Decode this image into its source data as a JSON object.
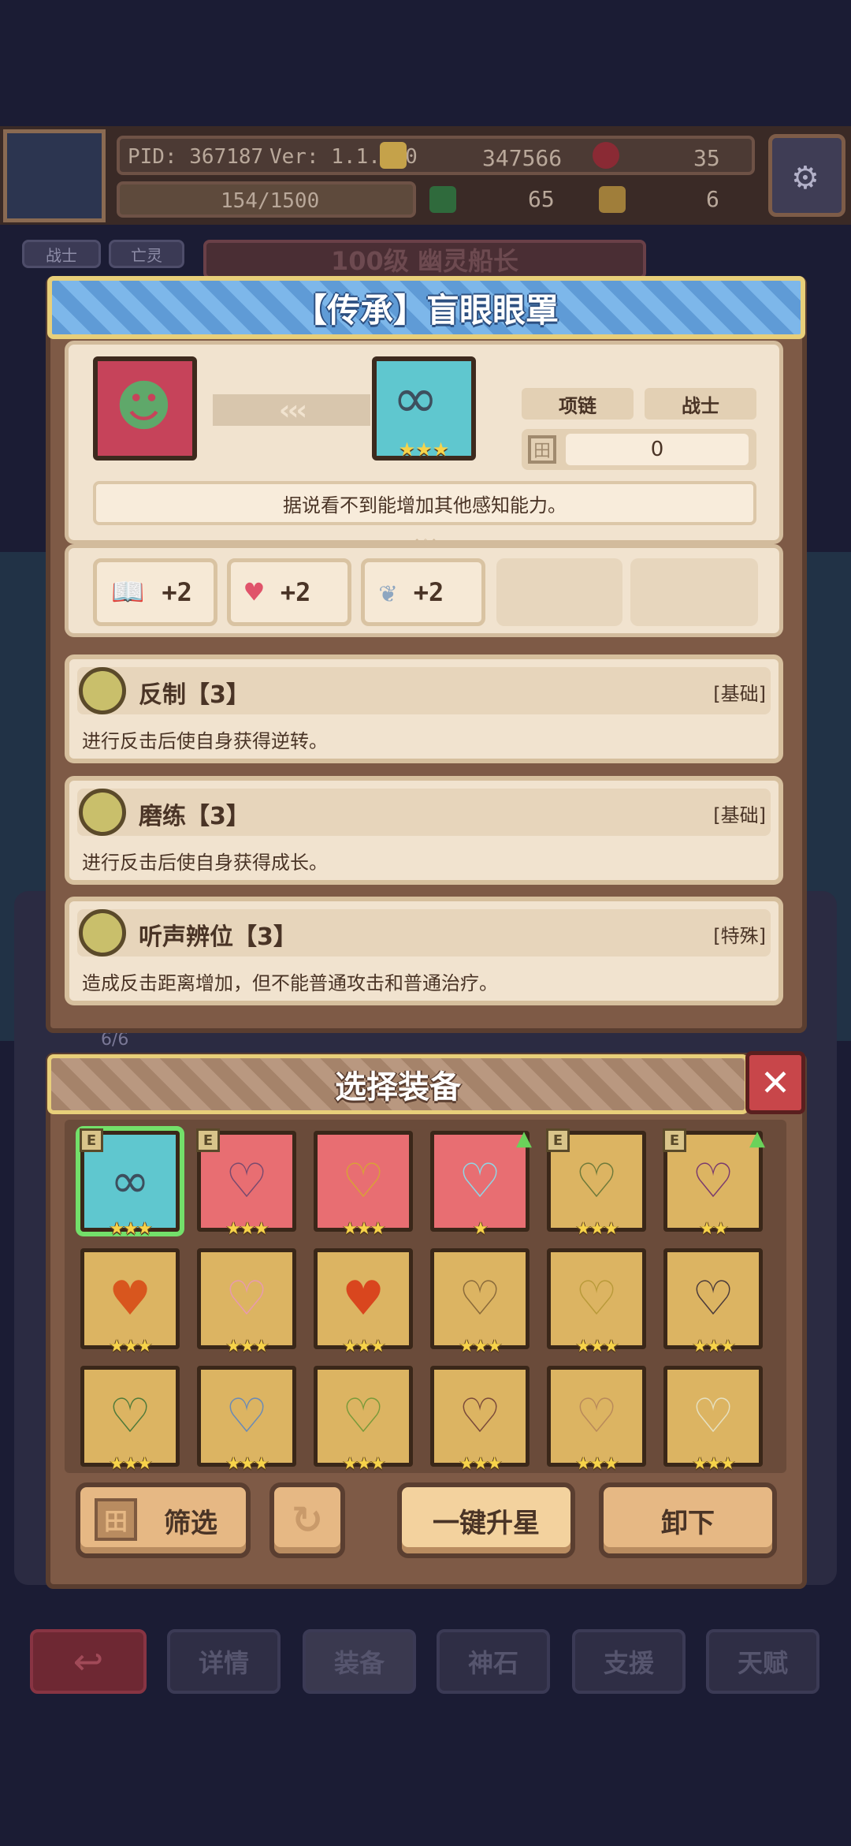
{
  "hud": {
    "pid": "PID: 367187",
    "version": "Ver: 1.1.2.0",
    "gold": "347566",
    "gem": "35",
    "exp": "154/1500",
    "clover": "65",
    "key": "6",
    "tag_class": "战士",
    "tag_race": "亡灵",
    "hero_title": "100级 幽灵船长",
    "side_count": "6/6"
  },
  "item": {
    "title": "【传承】盲眼眼罩",
    "type": "项链",
    "class": "战士",
    "level": "0",
    "arrows": "‹‹‹",
    "portrait_icon": "zombie-girl-icon",
    "item_icon": "blindfold-icon",
    "stars": "★★★",
    "description": "据说看不到能增加其他感知能力。",
    "stats": [
      {
        "icon": "book-icon",
        "symbol": "📖",
        "value": "+2"
      },
      {
        "icon": "heart-icon",
        "symbol": "♥",
        "value": "+2"
      },
      {
        "icon": "wing-icon",
        "symbol": "❦",
        "value": "+2"
      }
    ],
    "skills": [
      {
        "name": "反制【3】",
        "tag": "[基础]",
        "desc": "进行反击后使自身获得逆转。"
      },
      {
        "name": "磨练【3】",
        "tag": "[基础]",
        "desc": "进行反击后使自身获得成长。"
      },
      {
        "name": "听声辨位【3】",
        "tag": "[特殊]",
        "desc": "造成反击距离增加，但不能普通攻击和普通治疗。"
      }
    ]
  },
  "picker": {
    "title": "选择装备",
    "close": "✕",
    "equipped_mark": "E",
    "upgrade_mark": "▲",
    "slots": [
      {
        "bg": "#5fc7cf",
        "icon": "∞",
        "color": "#3d4f5e",
        "stars": "★★★",
        "equipped": true,
        "upgrade": false
      },
      {
        "bg": "#e86e72",
        "icon": "♡",
        "color": "#7a4a6e",
        "stars": "★★★",
        "equipped": true,
        "upgrade": false
      },
      {
        "bg": "#e86e72",
        "icon": "♡",
        "color": "#d9a038",
        "stars": "★★★",
        "equipped": false,
        "upgrade": false
      },
      {
        "bg": "#e86e72",
        "icon": "♡",
        "color": "#8fd6e6",
        "stars": "★",
        "equipped": false,
        "upgrade": true
      },
      {
        "bg": "#dcb462",
        "icon": "♡",
        "color": "#6f7a3a",
        "stars": "★★★",
        "equipped": true,
        "upgrade": false
      },
      {
        "bg": "#dcb462",
        "icon": "♡",
        "color": "#7a3a6e",
        "stars": "★★",
        "equipped": true,
        "upgrade": true
      },
      {
        "bg": "#dcb462",
        "icon": "♥",
        "color": "#d8561e",
        "stars": "★★★",
        "equipped": false,
        "upgrade": false
      },
      {
        "bg": "#dcb462",
        "icon": "♡",
        "color": "#e89ab0",
        "stars": "★★★",
        "equipped": false,
        "upgrade": false
      },
      {
        "bg": "#dcb462",
        "icon": "♥",
        "color": "#d9461e",
        "stars": "★★★",
        "equipped": false,
        "upgrade": false
      },
      {
        "bg": "#dcb462",
        "icon": "♡",
        "color": "#8a6a3a",
        "stars": "★★★",
        "equipped": false,
        "upgrade": false
      },
      {
        "bg": "#dcb462",
        "icon": "♡",
        "color": "#b99a3a",
        "stars": "★★★",
        "equipped": false,
        "upgrade": false
      },
      {
        "bg": "#dcb462",
        "icon": "♡",
        "color": "#4a3a3a",
        "stars": "★★★",
        "equipped": false,
        "upgrade": false
      },
      {
        "bg": "#dcb462",
        "icon": "♡",
        "color": "#4f7a3a",
        "stars": "★★★",
        "equipped": false,
        "upgrade": false
      },
      {
        "bg": "#dcb462",
        "icon": "♡",
        "color": "#6a8ab6",
        "stars": "★★★",
        "equipped": false,
        "upgrade": false
      },
      {
        "bg": "#dcb462",
        "icon": "♡",
        "color": "#7a9a3a",
        "stars": "★★★",
        "equipped": false,
        "upgrade": false
      },
      {
        "bg": "#dcb462",
        "icon": "♡",
        "color": "#7a4a3a",
        "stars": "★★★",
        "equipped": false,
        "upgrade": false
      },
      {
        "bg": "#dcb462",
        "icon": "♡",
        "color": "#b98a5a",
        "stars": "★★★",
        "equipped": false,
        "upgrade": false
      },
      {
        "bg": "#dcb462",
        "icon": "♡",
        "color": "#e6e0c0",
        "stars": "★★★",
        "equipped": false,
        "upgrade": false
      }
    ],
    "buttons": {
      "filter": "筛选",
      "refresh": "↻",
      "upgrade_all": "一键升星",
      "unequip": "卸下"
    }
  },
  "nav": {
    "back": "↩",
    "details": "详情",
    "equip": "装备",
    "stone": "神石",
    "support": "支援",
    "talent": "天赋"
  }
}
